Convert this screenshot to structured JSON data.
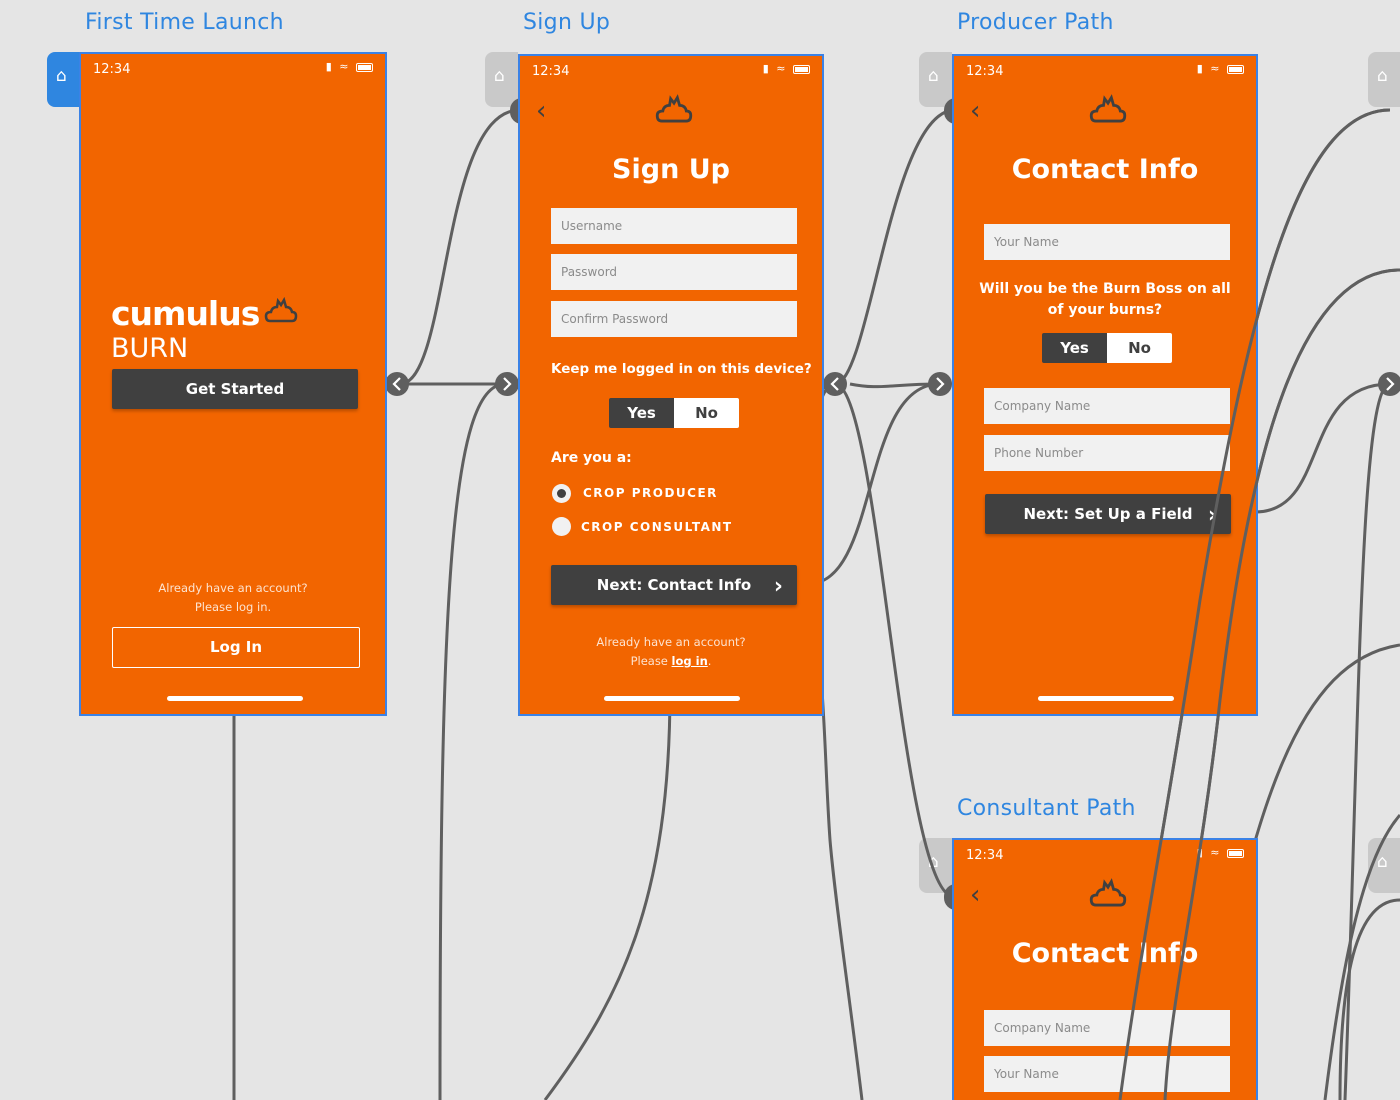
{
  "canvas": {
    "background": "#e5e5e5",
    "accent": "#2f86e0",
    "screen_color": "#f26500",
    "dark": "#404040"
  },
  "boards": {
    "first_time_launch": "First Time Launch",
    "sign_up": "Sign Up",
    "producer_path": "Producer Path",
    "consultant_path": "Consultant Path"
  },
  "status_time": "12:34",
  "launch": {
    "logo_word": "cumulus",
    "logo_burn": "BURN",
    "get_started": "Get Started",
    "account_line1": "Already have an account?",
    "account_line2": "Please log in.",
    "login": "Log In"
  },
  "signup": {
    "title": "Sign Up",
    "username_placeholder": "Username",
    "password_placeholder": "Password",
    "confirm_placeholder": "Confirm Password",
    "keep_logged_question": "Keep me logged in on this device?",
    "yes": "Yes",
    "no": "No",
    "are_you": "Are you a:",
    "option_producer": "CROP PRODUCER",
    "option_consultant": "CROP CONSULTANT",
    "next": "Next: Contact Info",
    "account_line1": "Already have an account?",
    "please": "Please",
    "login_link": "log in",
    "period": "."
  },
  "producer": {
    "title": "Contact Info",
    "name_placeholder": "Your Name",
    "burn_boss_q1": "Will you be the Burn Boss on all",
    "burn_boss_q2": "of your burns?",
    "yes": "Yes",
    "no": "No",
    "company_placeholder": "Company Name",
    "phone_placeholder": "Phone Number",
    "next": "Next: Set Up a Field"
  },
  "consultant": {
    "title": "Contact Info",
    "company_placeholder": "Company Name",
    "name_placeholder": "Your Name"
  },
  "icons": {
    "home": "home-icon",
    "back": "back-arrow-icon",
    "next": "chevron-right-icon",
    "logo": "cloud-flame-logo-icon"
  }
}
